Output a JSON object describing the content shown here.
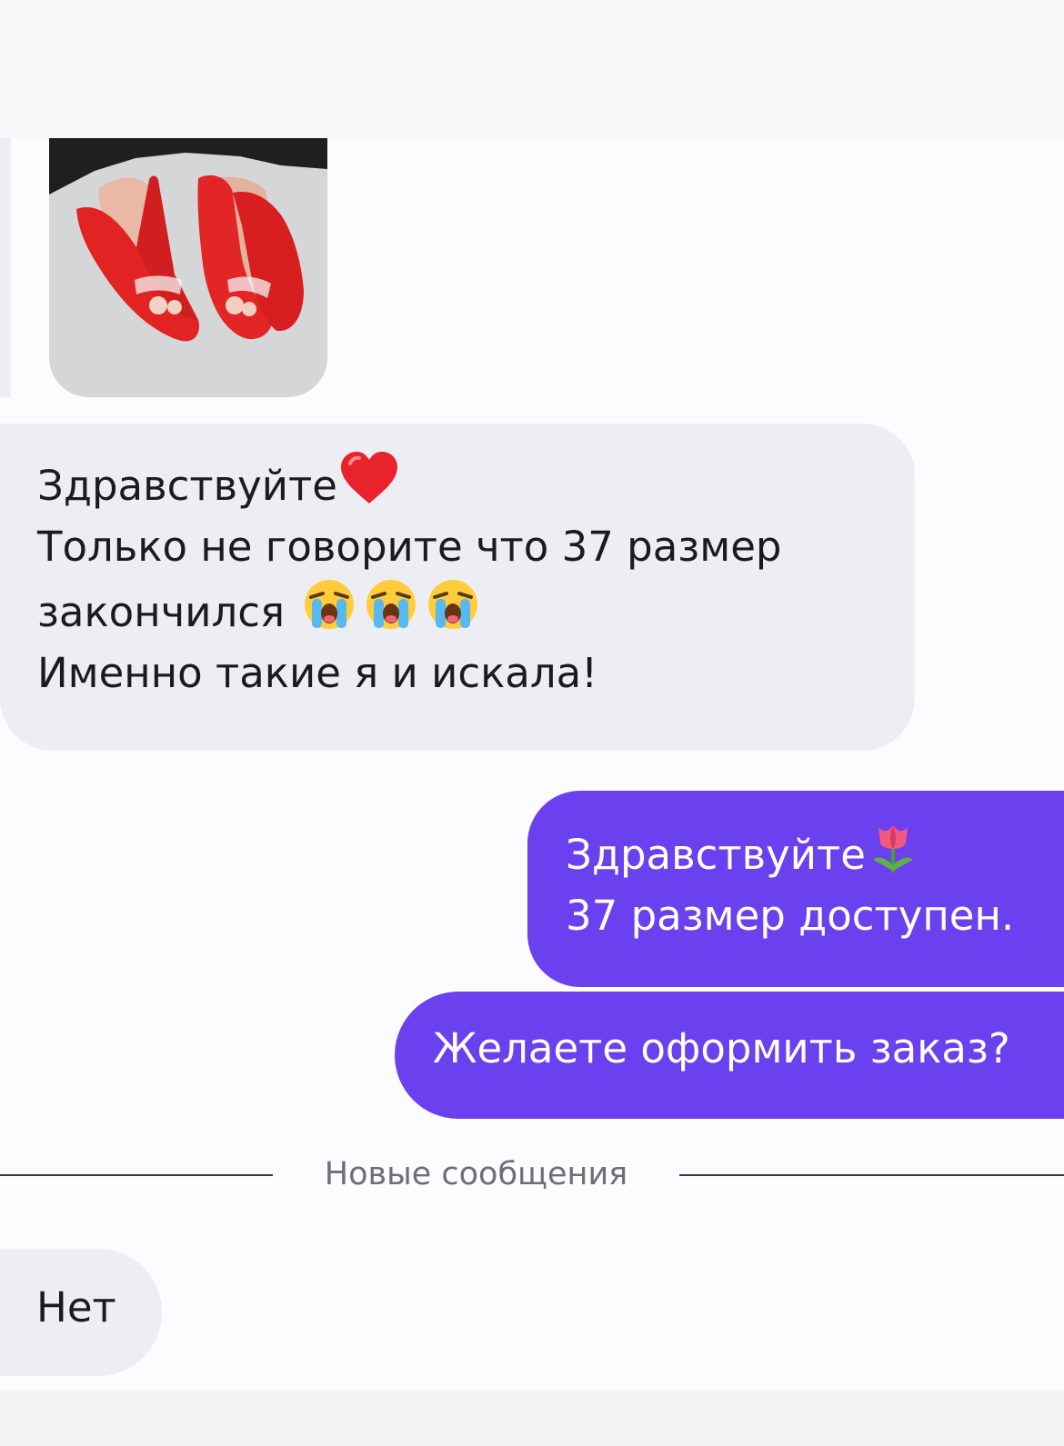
{
  "thread": {
    "incoming_photo": {
      "alt_subject": "red-flats"
    },
    "messages": [
      {
        "direction": "incoming",
        "lines": [
          "Здравствуйте",
          "Только не говорите что 37 размер",
          "закончился",
          "Именно такие я и искала!"
        ],
        "emojis": [
          "red-heart",
          "loudly-crying-face",
          "loudly-crying-face",
          "loudly-crying-face"
        ]
      },
      {
        "direction": "outgoing",
        "lines": [
          "Здравствуйте",
          "37 размер доступен."
        ],
        "emojis": [
          "tulip"
        ]
      },
      {
        "direction": "outgoing",
        "lines": [
          "Желаете оформить заказ?"
        ]
      },
      {
        "direction": "incoming",
        "lines": [
          "Нет"
        ]
      }
    ],
    "new_messages_divider": "Новые сообщения"
  },
  "colors": {
    "background": "#fcfbfe",
    "incoming_bubble": "#eceef3",
    "outgoing_bubble": "#6b40ee",
    "incoming_text": "#1b1b1f",
    "outgoing_text": "#ffffff",
    "divider_text": "#6e6e74"
  }
}
